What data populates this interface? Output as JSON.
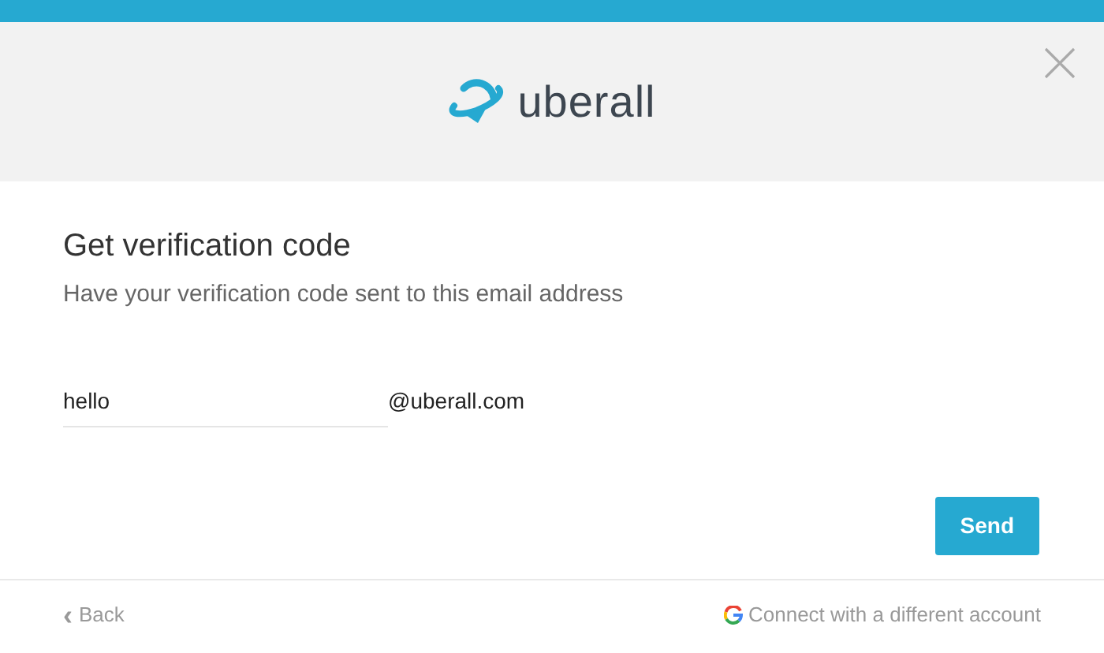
{
  "header": {
    "brand": "uberall"
  },
  "dialog": {
    "title": "Get verification code",
    "subtitle": "Have your verification code sent to this email address",
    "email_field": {
      "value": "hello",
      "suffix": "@uberall.com"
    },
    "send_button": "Send"
  },
  "footer": {
    "back_icon": "‹",
    "back": "Back",
    "connect": "Connect with a different account"
  }
}
